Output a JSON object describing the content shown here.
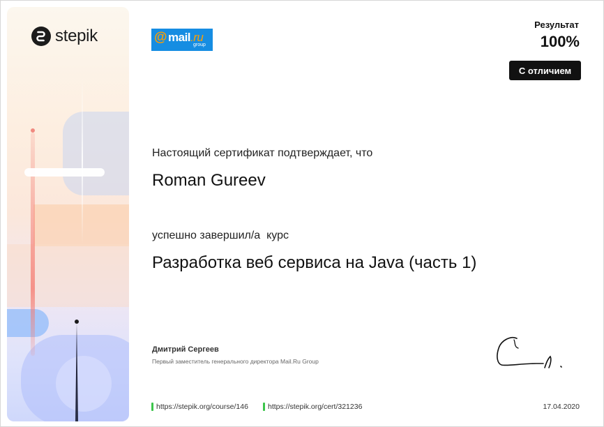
{
  "brand": {
    "logo_text": "stepik",
    "logo_icon": "stepik-icon"
  },
  "partner": {
    "at": "@",
    "name": "mail",
    "tld": ".ru",
    "group": "group",
    "accent": "#168de2"
  },
  "result": {
    "label": "Результат",
    "value": "100%",
    "badge": "С отличием"
  },
  "certificate": {
    "confirm_text": "Настоящий сертификат подтверждает, что",
    "recipient": "Roman Gureev",
    "completed_text": "успешно завершил/а  курс",
    "course_title": "Разработка веб сервиса на Java (часть 1)"
  },
  "signer": {
    "name": "Дмитрий Сергеев",
    "role": "Первый заместитель генерального директора Mail.Ru Group"
  },
  "footer": {
    "course_link": "https://stepik.org/course/146",
    "cert_link": "https://stepik.org/cert/321236",
    "date": "17.04.2020",
    "link_marker_color": "#3cc54b"
  }
}
